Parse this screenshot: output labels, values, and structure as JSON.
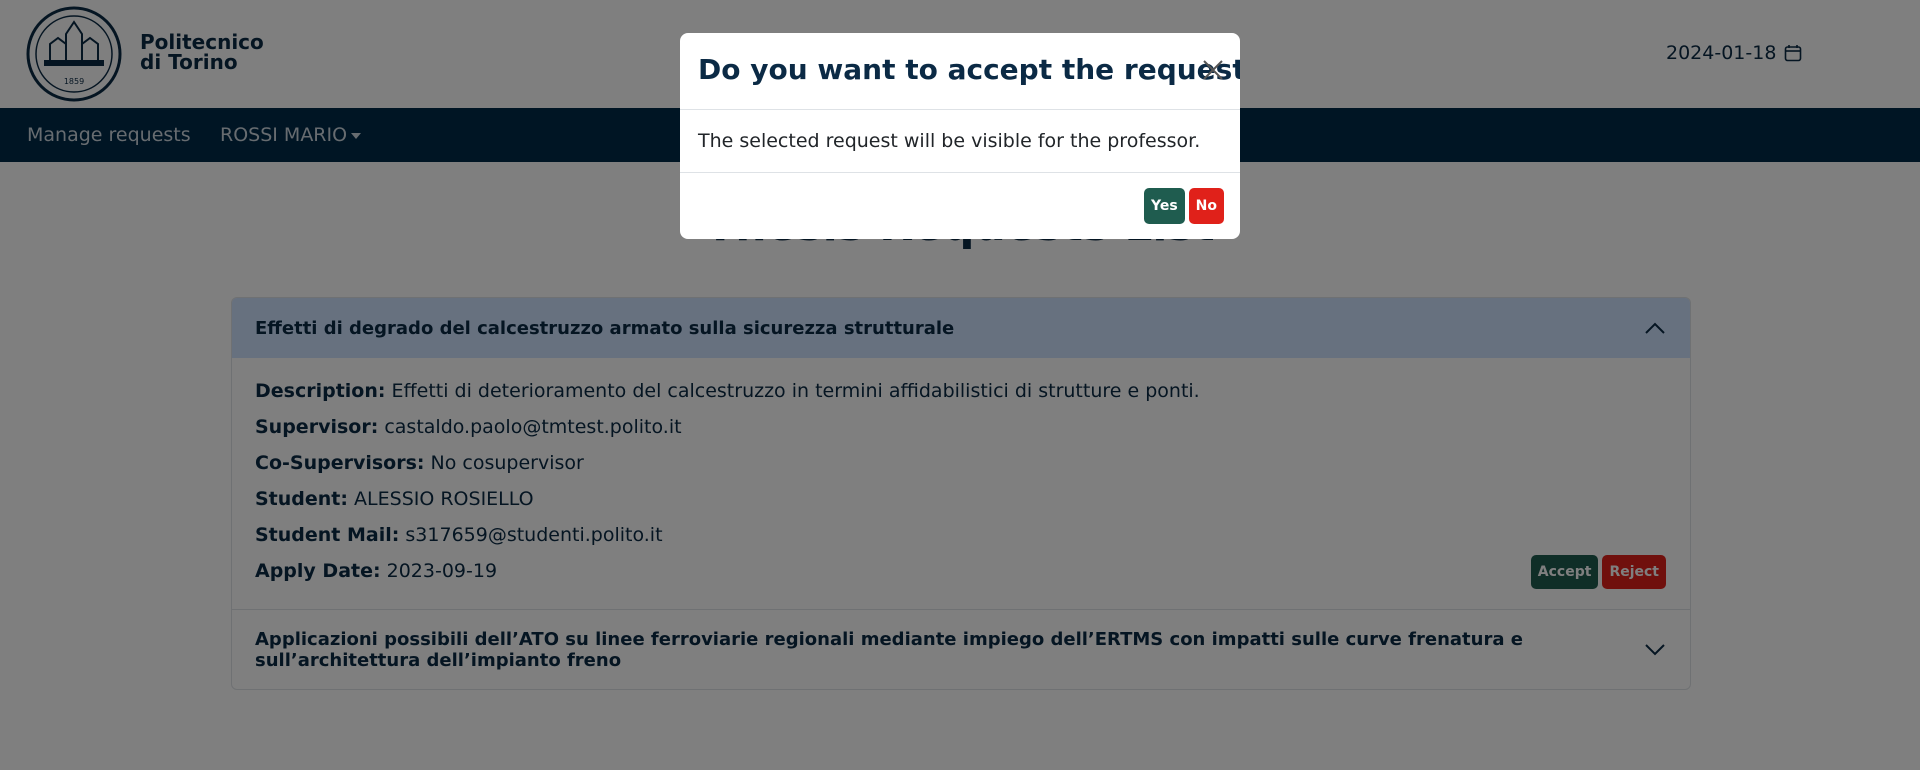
{
  "header": {
    "brand_line1": "Politecnico",
    "brand_line2": "di Torino",
    "date": "2024-01-18",
    "logo_year": "1859"
  },
  "navbar": {
    "manage_requests": "Manage requests",
    "user_menu": "ROSSI MARIO"
  },
  "page": {
    "title": "Thesis Requests List"
  },
  "requests": [
    {
      "title": "Effetti di degrado del calcestruzzo armato sulla sicurezza strutturale",
      "fields": [
        {
          "label": "Description:",
          "value": "Effetti di deterioramento del calcestruzzo in termini affidabilistici di strutture e ponti."
        },
        {
          "label": "Supervisor:",
          "value": "castaldo.paolo@tmtest.polito.it"
        },
        {
          "label": "Co-Supervisors:",
          "value": "No cosupervisor"
        },
        {
          "label": "Student:",
          "value": "ALESSIO ROSIELLO"
        },
        {
          "label": "Student Mail:",
          "value": "s317659@studenti.polito.it"
        },
        {
          "label": "Apply Date:",
          "value": "2023-09-19"
        }
      ],
      "accept_label": "Accept",
      "reject_label": "Reject"
    },
    {
      "title": "Applicazioni possibili dell’ATO su linee ferroviarie regionali mediante impiego dell’ERTMS con impatti sulle curve frenatura e sull’architettura dell’impianto freno"
    }
  ],
  "modal": {
    "title": "Do you want to accept the request?",
    "body": "The selected request will be visible for the professor.",
    "yes_label": "Yes",
    "no_label": "No"
  },
  "colors": {
    "navy": "#002b49",
    "accept_green": "#1f5c4f",
    "reject_red": "#e0211a",
    "open_header_bg": "#cfe2ff"
  },
  "icons": {
    "calendar": "calendar-icon",
    "chevron_up": "chevron-up-icon",
    "chevron_down": "chevron-down-icon",
    "close": "close-icon"
  }
}
